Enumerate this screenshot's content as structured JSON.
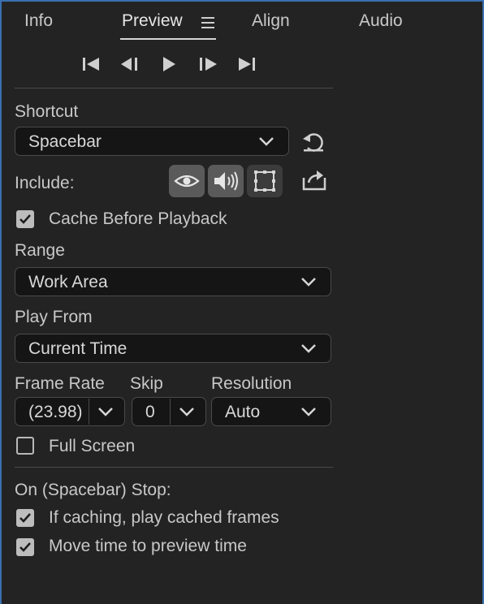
{
  "tabs": [
    {
      "label": "Info"
    },
    {
      "label": "Preview"
    },
    {
      "label": "Align"
    },
    {
      "label": "Audio"
    }
  ],
  "shortcut": {
    "label": "Shortcut",
    "value": "Spacebar"
  },
  "include": {
    "label": "Include:"
  },
  "cache_before_playback": {
    "label": "Cache Before Playback",
    "checked": true
  },
  "range": {
    "label": "Range",
    "value": "Work Area"
  },
  "play_from": {
    "label": "Play From",
    "value": "Current Time"
  },
  "frame_rate": {
    "label": "Frame Rate",
    "value": "(23.98)"
  },
  "skip": {
    "label": "Skip",
    "value": "0"
  },
  "resolution": {
    "label": "Resolution",
    "value": "Auto"
  },
  "full_screen": {
    "label": "Full Screen",
    "checked": false
  },
  "on_stop": {
    "label": "On (Spacebar) Stop:"
  },
  "play_cached": {
    "label": "If caching, play cached frames",
    "checked": true
  },
  "move_time": {
    "label": "Move time to preview time",
    "checked": true
  },
  "icons": [
    "skip-to-start-icon",
    "step-back-icon",
    "play-icon",
    "step-forward-icon",
    "skip-to-end-icon",
    "reset-icon",
    "video-icon",
    "audio-icon",
    "overlays-icon",
    "export-icon",
    "menu-icon",
    "chevron-down-icon",
    "check-icon"
  ],
  "colors": {
    "background": "#232323",
    "panel_border": "#3a6fb0",
    "text": "#c8c8c8",
    "field": "#151515"
  }
}
